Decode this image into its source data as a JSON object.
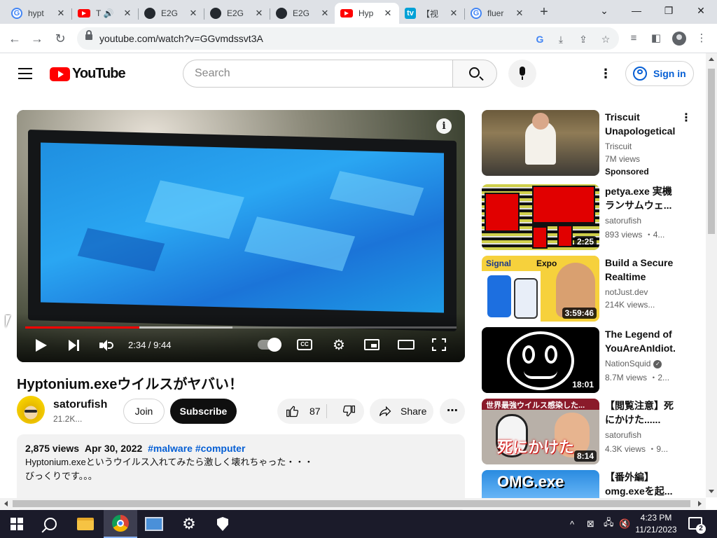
{
  "browser": {
    "tabs": [
      {
        "title": "hypt",
        "icon": "google-icon",
        "active": false
      },
      {
        "title": "T",
        "icon": "youtube-icon",
        "active": false,
        "audio": true
      },
      {
        "title": "E2G",
        "icon": "github-icon",
        "active": false
      },
      {
        "title": "E2G",
        "icon": "github-icon",
        "active": false
      },
      {
        "title": "E2G",
        "icon": "github-icon",
        "active": false
      },
      {
        "title": "Hyp",
        "icon": "youtube-icon",
        "active": true
      },
      {
        "title": "【视",
        "icon": "bilibili-icon",
        "active": false
      },
      {
        "title": "fluer",
        "icon": "google-icon",
        "active": false
      }
    ],
    "url": "youtube.com/watch?v=GGvmdssvt3A"
  },
  "header": {
    "logo_text": "YouTube",
    "search_placeholder": "Search",
    "signin_label": "Sign in"
  },
  "player": {
    "time": "2:34 / 9:44",
    "played_fraction": 0.264,
    "loaded_fraction": 0.48,
    "info_glyph": "i",
    "cc_label": "CC"
  },
  "video": {
    "title": "Hyptonium.exeウイルスがヤバい！",
    "channel": "satorufish",
    "subscribers": "21.2K...",
    "join_label": "Join",
    "subscribe_label": "Subscribe",
    "likes": "87",
    "share_label": "Share",
    "views": "2,875 views",
    "date": "Apr 30, 2022",
    "tags": [
      "#malware",
      "#computer"
    ],
    "description": [
      "Hyptonium.exeというウイルス入れてみたら激しく壊れちゃった・・・",
      "びっくりです。。。"
    ]
  },
  "recommendations": [
    {
      "title": "Triscuit Unapologetical...",
      "channel": "Triscuit",
      "meta": "7M views",
      "sponsored": "Sponsored",
      "duration": ""
    },
    {
      "title": "petya.exe 実機ランサムウェ...",
      "channel": "satorufish",
      "meta": "893 views ・4...",
      "duration": "2:25"
    },
    {
      "title": "Build a Secure Realtime Chat...",
      "channel": "notJust.dev",
      "meta": "214K views...",
      "duration": "3:59:46",
      "thumb_text": [
        "Signal",
        "Expo"
      ]
    },
    {
      "title": "The Legend of YouAreAnIdiot.c",
      "channel": "NationSquid",
      "verified": true,
      "meta": "8.7M views ・2...",
      "duration": "18:01"
    },
    {
      "title": "【閲覧注意】死にかけた......",
      "channel": "satorufish",
      "meta": "4.3K views ・9...",
      "duration": "8:14",
      "thumb_text": [
        "世界最強ウイルス感染した...",
        "死にかけた"
      ]
    },
    {
      "title": "【番外編】 omg.exeを起...",
      "channel": "",
      "meta": "",
      "duration": "",
      "thumb_text": [
        "OMG.exe"
      ]
    }
  ],
  "taskbar": {
    "time": "4:23 PM",
    "date": "11/21/2023",
    "notification_count": "2"
  },
  "colors": {
    "youtube_red": "#ff0000",
    "link_blue": "#065fd4",
    "taskbar": "#1b1b2a"
  }
}
